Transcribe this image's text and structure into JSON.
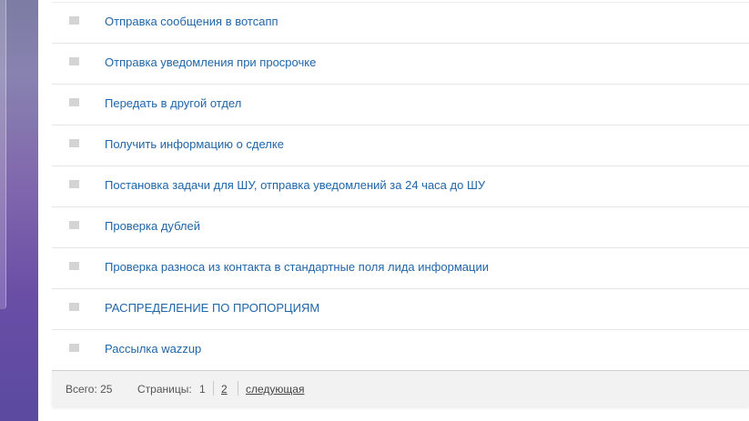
{
  "list": {
    "items": [
      {
        "label": "Отправка сообщения в вотсапп"
      },
      {
        "label": "Отправка уведомления при просрочке"
      },
      {
        "label": "Передать в другой отдел"
      },
      {
        "label": "Получить информацию о сделке"
      },
      {
        "label": "Постановка задачи для ШУ, отправка уведомлений за 24 часа до ШУ"
      },
      {
        "label": "Проверка дублей"
      },
      {
        "label": "Проверка разноса из контакта в стандартные поля лида информации"
      },
      {
        "label": "РАСПРЕДЕЛЕНИЕ ПО ПРОПОРЦИЯМ"
      },
      {
        "label": "Рассылка wazzup"
      }
    ]
  },
  "footer": {
    "total": "Всего: 25",
    "pages_label": "Страницы:",
    "current_page": "1",
    "page_2": "2",
    "next": "следующая"
  },
  "colors": {
    "link": "#2066a9",
    "sidebar_gradient": "#7c7ca4 → #5a4aa0"
  }
}
